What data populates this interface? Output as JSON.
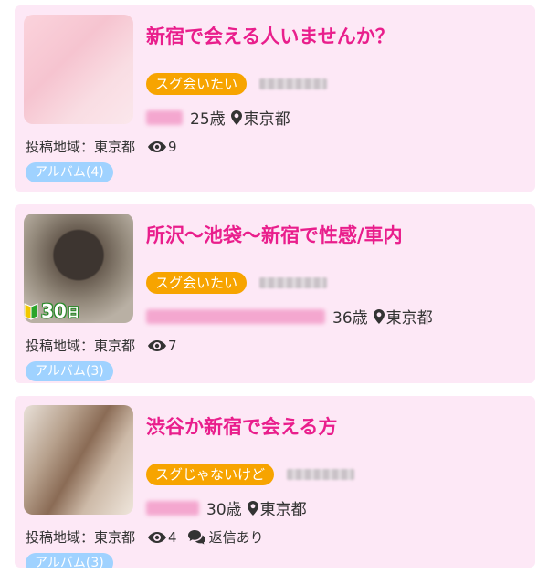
{
  "posts": [
    {
      "title": "新宿で会える人いませんか？",
      "tag": "スグ会いたい",
      "age": "25歳",
      "location": "東京都",
      "area_label": "投稿地域：",
      "area_value": "東京都",
      "views": "9",
      "album": "アルバム(4)"
    },
    {
      "title": "所沢～池袋～新宿で性感/車内",
      "tag": "スグ会いたい",
      "age": "36歳",
      "location": "東京都",
      "area_label": "投稿地域：",
      "area_value": "東京都",
      "views": "7",
      "album": "アルバム(3)",
      "badge_num": "30",
      "badge_unit": "日"
    },
    {
      "title": "渋谷か新宿で会える方",
      "tag": "スグじゃないけど",
      "age": "30歳",
      "location": "東京都",
      "area_label": "投稿地域：",
      "area_value": "東京都",
      "views": "4",
      "reply": "返信あり",
      "album": "アルバム(3)"
    }
  ],
  "icons": {
    "pin": "map-pin-icon",
    "eye": "eye-icon",
    "chat": "chat-bubbles-icon",
    "leaf": "beginner-leaf-icon"
  },
  "colors": {
    "card_bg": "#fde8f6",
    "title": "#e91e8c",
    "tag": "#f7a400",
    "album": "#9fd2ff"
  }
}
